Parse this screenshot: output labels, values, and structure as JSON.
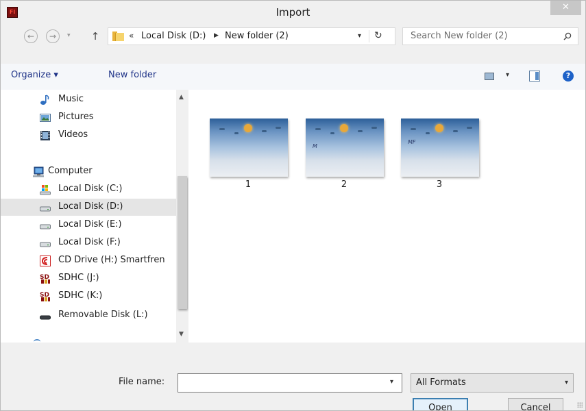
{
  "window": {
    "title": "Import",
    "close_glyph": "✕",
    "app_icon": "Fl"
  },
  "address": {
    "crumbs_prefix": "«",
    "crumbs": [
      "Local Disk (D:)",
      "New folder (2)"
    ],
    "search_placeholder": "Search New folder (2)"
  },
  "toolbar": {
    "organize": "Organize ▾",
    "new_folder": "New folder"
  },
  "nav": {
    "items": [
      {
        "label": "Music",
        "icon": "music-icon"
      },
      {
        "label": "Pictures",
        "icon": "pictures-icon"
      },
      {
        "label": "Videos",
        "icon": "videos-icon"
      },
      {
        "label": "Computer",
        "icon": "computer-icon"
      },
      {
        "label": "Local Disk (C:)",
        "icon": "system-drive-icon"
      },
      {
        "label": "Local Disk (D:)",
        "icon": "drive-icon",
        "selected": true
      },
      {
        "label": "Local Disk (E:)",
        "icon": "drive-icon"
      },
      {
        "label": "Local Disk (F:)",
        "icon": "drive-icon"
      },
      {
        "label": "CD Drive (H:) Smartfren",
        "icon": "cd-drive-icon"
      },
      {
        "label": "SDHC (J:)",
        "icon": "sd-card-icon"
      },
      {
        "label": "SDHC (K:)",
        "icon": "sd-card-icon"
      },
      {
        "label": "Removable Disk (L:)",
        "icon": "removable-disk-icon"
      }
    ]
  },
  "files": [
    {
      "name": "1",
      "thumb_mark": ""
    },
    {
      "name": "2",
      "thumb_mark": "M"
    },
    {
      "name": "3",
      "thumb_mark": "MF"
    }
  ],
  "bottom": {
    "file_name_label": "File name:",
    "file_name_value": "",
    "format": "All Formats",
    "open_label": "Open",
    "cancel_label": "Cancel"
  },
  "colors": {
    "accent": "#3c7fb1",
    "link": "#1e3287",
    "selection": "#e5e5e5"
  }
}
